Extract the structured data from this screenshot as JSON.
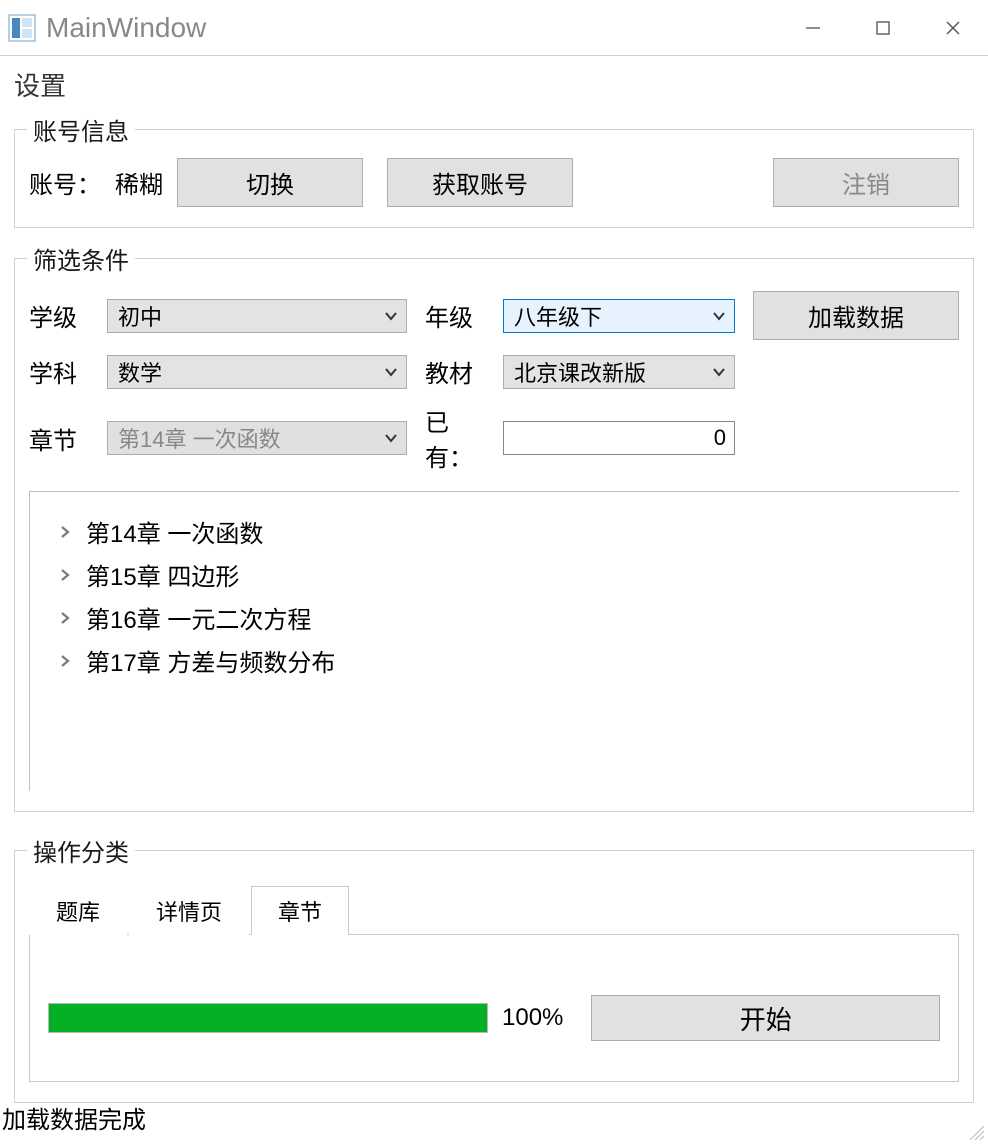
{
  "window": {
    "title": "MainWindow"
  },
  "page_heading": "设置",
  "account": {
    "legend": "账号信息",
    "label": "账号：",
    "value": "稀糊",
    "switch_label": "切换",
    "fetch_label": "获取账号",
    "logout_label": "注销"
  },
  "filter": {
    "legend": "筛选条件",
    "labels": {
      "stage": "学级",
      "grade": "年级",
      "subject": "学科",
      "textbook": "教材",
      "chapter": "章节",
      "existing": "已有："
    },
    "values": {
      "stage": "初中",
      "grade": "八年级下",
      "subject": "数学",
      "textbook": "北京课改新版",
      "chapter": "第14章 一次函数",
      "existing": "0"
    },
    "load_button": "加载数据",
    "tree": [
      "第14章 一次函数",
      "第15章 四边形",
      "第16章  一元二次方程",
      "第17章 方差与频数分布"
    ]
  },
  "ops": {
    "legend": "操作分类",
    "tabs": [
      "题库",
      "详情页",
      "章节"
    ],
    "active_tab_index": 2,
    "progress_pct": 100,
    "progress_text": "100%",
    "start_label": "开始"
  },
  "status_text": "加载数据完成"
}
